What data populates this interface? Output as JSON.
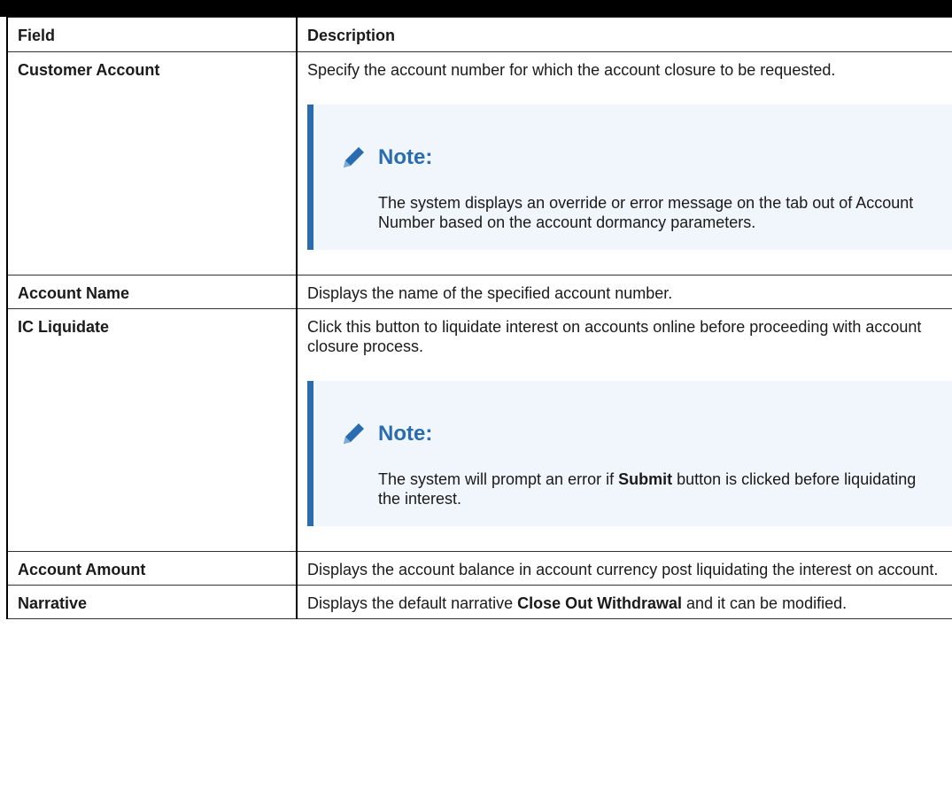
{
  "header": {
    "field": "Field",
    "description": "Description"
  },
  "rows": [
    {
      "field": "Customer Account",
      "description": "Specify the account number for which the account closure to be requested.",
      "note": {
        "title": "Note:",
        "text": "The system displays an override or error message on the tab out of Account Number based on the account dormancy parameters."
      }
    },
    {
      "field": "Account Name",
      "description": "Displays the name of the specified account number."
    },
    {
      "field": "IC Liquidate",
      "description": "Click this button to liquidate interest on accounts online before proceeding with account closure process.",
      "note": {
        "title": "Note:",
        "text_before": "The system will prompt an error if ",
        "text_bold": "Submit",
        "text_after": " button is clicked before liquidating the interest."
      }
    },
    {
      "field": "Account Amount",
      "description": "Displays the account balance in account currency post liquidating the interest on account."
    },
    {
      "field": "Narrative",
      "description_before": "Displays the default narrative ",
      "description_bold": "Close Out Withdrawal",
      "description_after": " and it can be modified."
    }
  ],
  "icons": {
    "note": "pencil-icon"
  },
  "colors": {
    "note_accent": "#2a6cb0",
    "note_background": "#f0f6fc"
  }
}
